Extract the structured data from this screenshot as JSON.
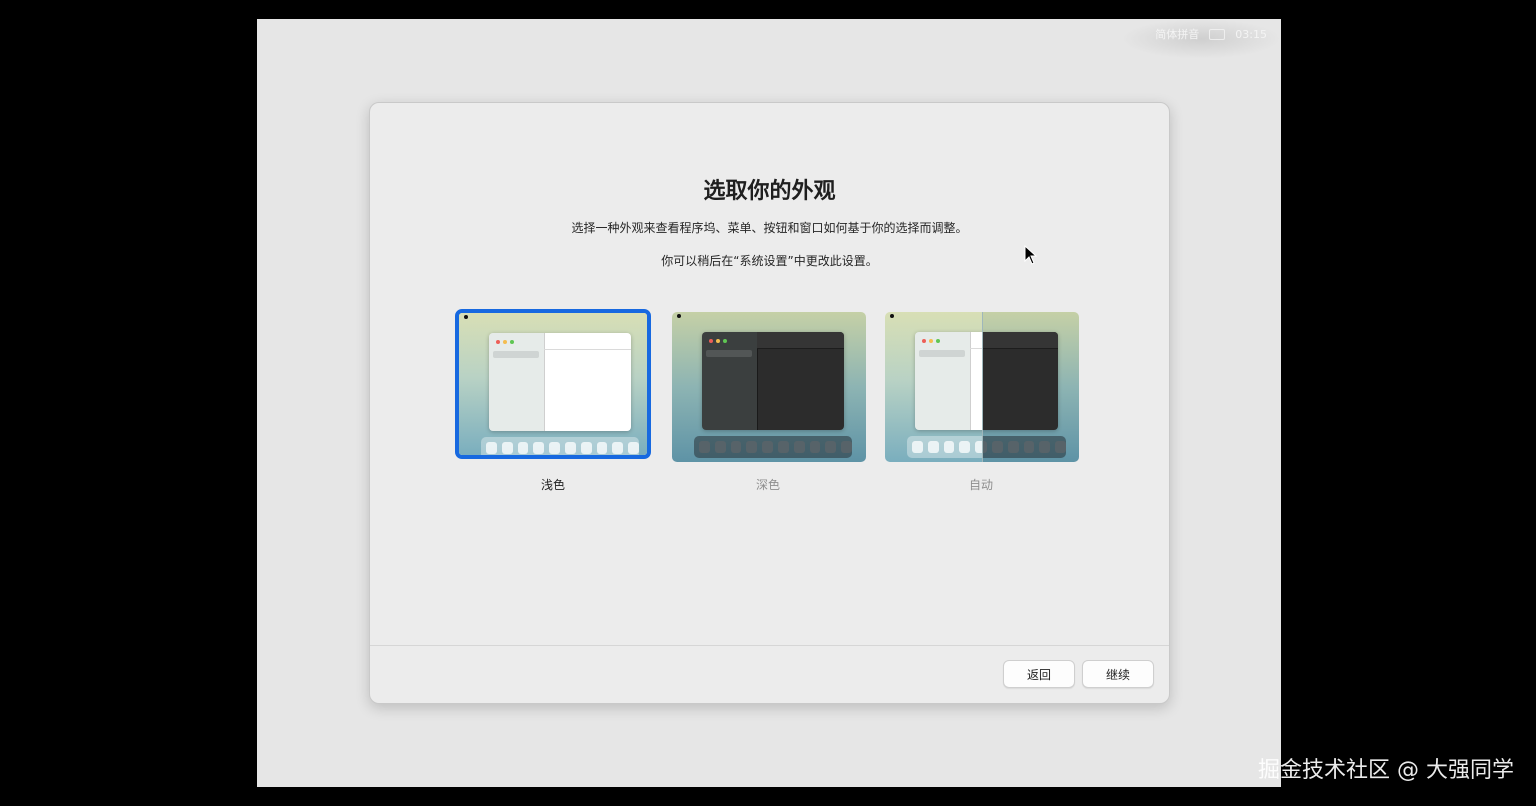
{
  "status_bar": {
    "input_method": "简体拼音",
    "time": "03:15",
    "keyboard_icon": "keyboard-icon"
  },
  "dialog": {
    "title": "选取你的外观",
    "subtitle": "选择一种外观来查看程序坞、菜单、按钮和窗口如何基于你的选择而调整。",
    "note": "你可以稍后在“系统设置”中更改此设置。",
    "options": [
      {
        "label": "浅色",
        "selected": true
      },
      {
        "label": "深色",
        "selected": false
      },
      {
        "label": "自动",
        "selected": false
      }
    ],
    "buttons": {
      "back": "返回",
      "continue": "继续"
    }
  },
  "watermark": "掘金技术社区 @ 大强同学",
  "colors": {
    "selection": "#1769e0",
    "dialog_bg": "#ececec",
    "screen_bg": "#e6e6e6"
  }
}
